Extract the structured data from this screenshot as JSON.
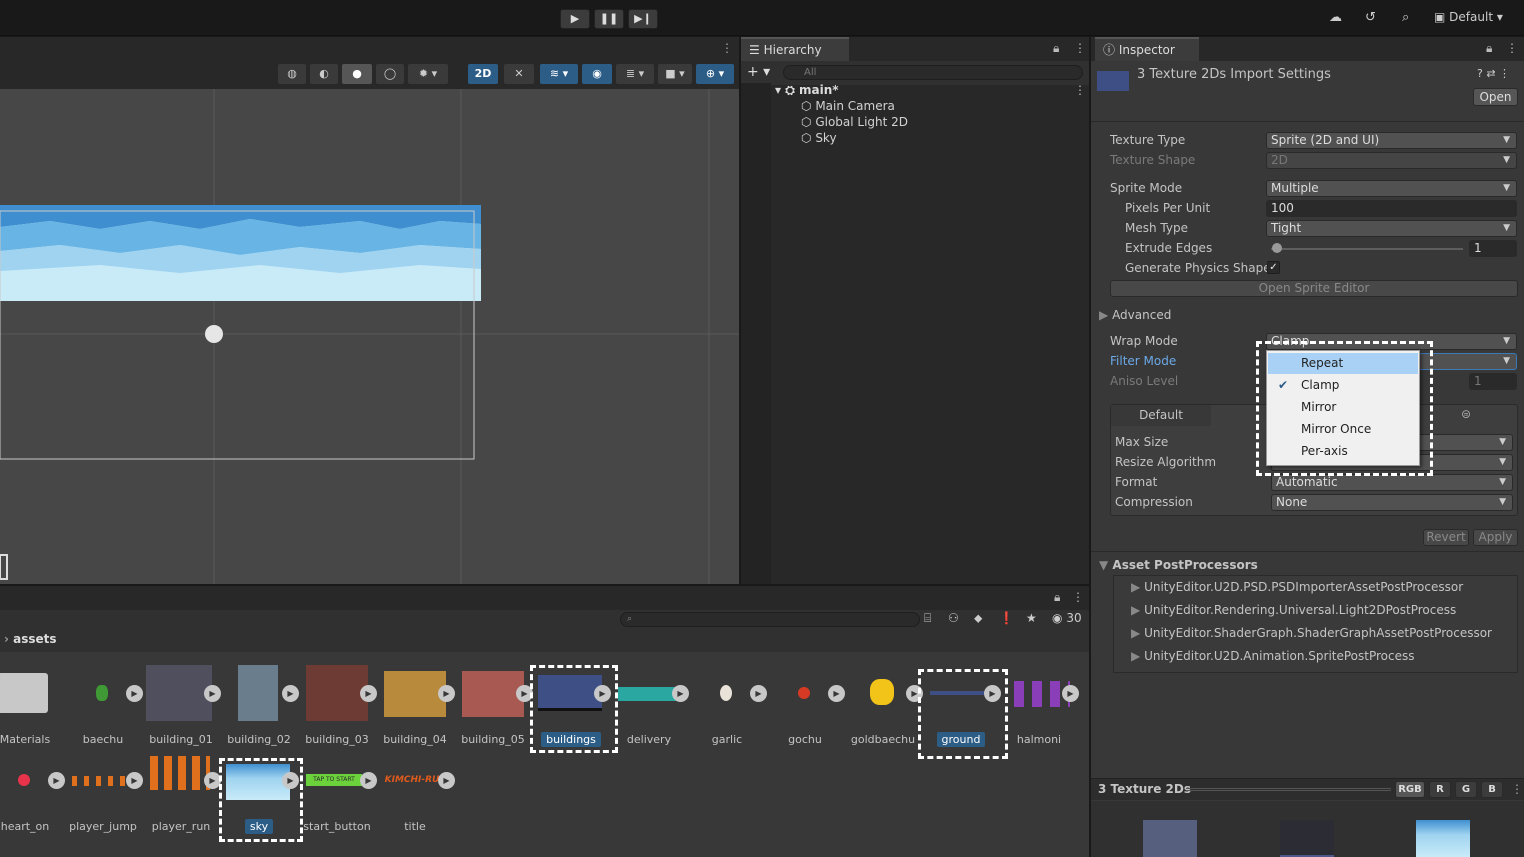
{
  "toolbar": {
    "layout_label": "Default"
  },
  "hierarchy": {
    "tab_label": "Hierarchy",
    "search_placeholder": "All",
    "scene_name": "main*",
    "items": [
      "Main Camera",
      "Global Light 2D",
      "Sky"
    ]
  },
  "scene": {
    "mode_2d_label": "2D"
  },
  "inspector": {
    "tab_label": "Inspector",
    "title": "3 Texture 2Ds Import Settings",
    "open_label": "Open",
    "texture_type": {
      "label": "Texture Type",
      "value": "Sprite (2D and UI)"
    },
    "texture_shape": {
      "label": "Texture Shape",
      "value": "2D"
    },
    "sprite_mode": {
      "label": "Sprite Mode",
      "value": "Multiple"
    },
    "pixels_per_unit": {
      "label": "Pixels Per Unit",
      "value": "100"
    },
    "mesh_type": {
      "label": "Mesh Type",
      "value": "Tight"
    },
    "extrude_edges": {
      "label": "Extrude Edges",
      "value": "1"
    },
    "generate_physics_shape": {
      "label": "Generate Physics Shape",
      "checked": true
    },
    "open_sprite_editor_label": "Open Sprite Editor",
    "advanced_label": "Advanced",
    "wrap_mode": {
      "label": "Wrap Mode",
      "value": "Clamp"
    },
    "filter_mode": {
      "label": "Filter Mode"
    },
    "aniso_level": {
      "label": "Aniso Level",
      "value": "1"
    },
    "platform_tab": "Default",
    "max_size_label": "Max Size",
    "resize_algorithm_label": "Resize Algorithm",
    "format": {
      "label": "Format",
      "value": "Automatic"
    },
    "compression": {
      "label": "Compression",
      "value": "None"
    },
    "revert_label": "Revert",
    "apply_label": "Apply",
    "postprocessors_label": "Asset PostProcessors",
    "postprocessors": [
      "UnityEditor.U2D.PSD.PSDImporterAssetPostProcessor",
      "UnityEditor.Rendering.Universal.Light2DPostProcess",
      "UnityEditor.ShaderGraph.ShaderGraphAssetPostProcessor",
      "UnityEditor.U2D.Animation.SpritePostProcess"
    ],
    "preview_title": "3 Texture 2Ds",
    "channels": [
      "RGB",
      "R",
      "G",
      "B"
    ]
  },
  "wrap_dropdown": {
    "options": [
      "Repeat",
      "Clamp",
      "Mirror",
      "Mirror Once",
      "Per-axis"
    ],
    "highlighted": "Repeat",
    "checked": "Clamp"
  },
  "project": {
    "breadcrumb": "assets",
    "count": "30",
    "assets_row1": [
      "Materials",
      "baechu",
      "building_01",
      "building_02",
      "building_03",
      "building_04",
      "building_05",
      "buildings",
      "delivery",
      "garlic",
      "gochu",
      "goldbaechu",
      "ground",
      "halmoni"
    ],
    "assets_row2": [
      "heart_on",
      "player_jump",
      "player_run",
      "sky",
      "start_button",
      "title"
    ],
    "selected": [
      "buildings",
      "ground",
      "sky"
    ],
    "start_button_text": "TAP TO START",
    "title_text": "KIMCHI-RU"
  },
  "colors": {
    "accent": "#2c5d87",
    "selection": "#a8d1f5",
    "sky": "#a9d8f0"
  }
}
